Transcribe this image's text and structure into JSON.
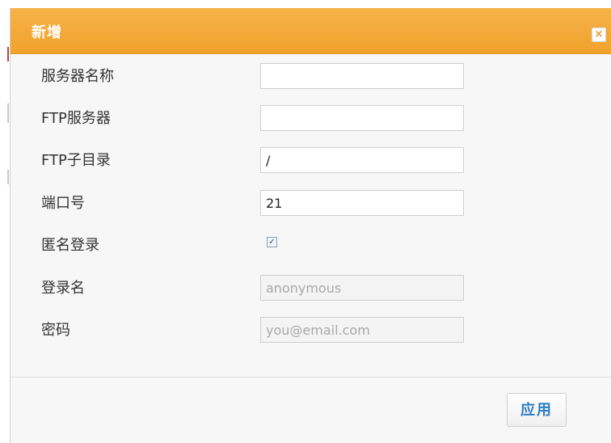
{
  "dialog": {
    "title": "新增",
    "close_icon": "close-icon",
    "close_glyph": "×",
    "accent_color": "#f1a22a",
    "button_text_color": "#2a7dc4"
  },
  "form": {
    "server_name": {
      "label": "服务器名称",
      "value": "",
      "placeholder": ""
    },
    "ftp_server": {
      "label": "FTP服务器",
      "value": "",
      "placeholder": ""
    },
    "ftp_subdir": {
      "label": "FTP子目录",
      "value": "/",
      "placeholder": ""
    },
    "port": {
      "label": "端口号",
      "value": "21",
      "placeholder": ""
    },
    "anonymous": {
      "label": "匿名登录",
      "checked": true,
      "check_glyph": "✓"
    },
    "login_name": {
      "label": "登录名",
      "value": "",
      "placeholder": "anonymous"
    },
    "password": {
      "label": "密码",
      "value": "",
      "placeholder": "you@email.com"
    }
  },
  "footer": {
    "apply_label": "应用"
  }
}
